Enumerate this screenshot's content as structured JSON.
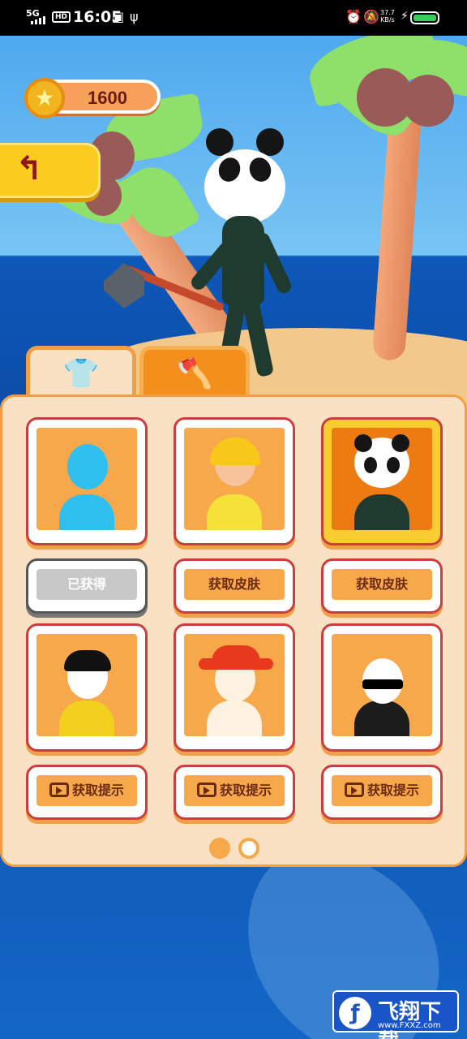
{
  "status_bar": {
    "network": "5G",
    "hd": "HD",
    "time": "16:05",
    "speed_value": "37.7",
    "speed_unit": "KB/s",
    "icons": [
      "signal-icon",
      "usb-icon",
      "alarm-icon",
      "mute-icon",
      "charging-icon",
      "battery-icon"
    ]
  },
  "hud": {
    "coins": "1600",
    "coin_icon": "star-coin-icon",
    "back_icon": "back-arrow-icon"
  },
  "tabs": [
    {
      "icon": "shirt-icon",
      "active": true
    },
    {
      "icon": "axe-icon",
      "active": false
    }
  ],
  "skins_row1": [
    {
      "desc": "cyan-stickman",
      "button": "已获得",
      "state": "owned"
    },
    {
      "desc": "construction-worker",
      "button": "获取皮肤",
      "state": "locked"
    },
    {
      "desc": "panda",
      "button": "获取皮肤",
      "state": "selected"
    }
  ],
  "skins_row2": [
    {
      "desc": "black-hair-yellow-shirt",
      "button": "获取提示"
    },
    {
      "desc": "red-hat-pirate",
      "button": "获取提示"
    },
    {
      "desc": "bald-sunglasses-suit",
      "button": "获取提示"
    }
  ],
  "pagination": {
    "current": 1,
    "total": 2
  },
  "watermark": {
    "title": "飞翔下载",
    "url": "www.FXXZ.com"
  },
  "colors": {
    "panel_bg": "#fbe1c3",
    "card_border": "#c93e3e",
    "card_fill": "#f6a84a",
    "accent_orange": "#f39e44",
    "coin_text": "#6a1c13"
  }
}
